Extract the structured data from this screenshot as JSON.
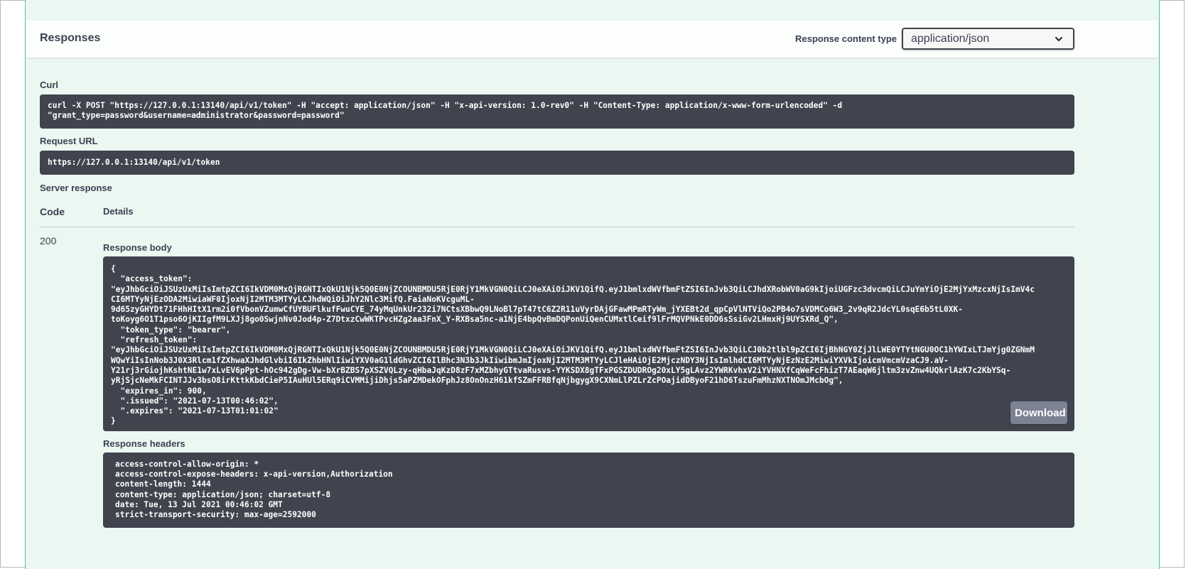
{
  "responses": {
    "title": "Responses",
    "content_type_label": "Response content type",
    "content_type_value": "application/json"
  },
  "curl": {
    "label": "Curl",
    "lines": [
      "curl -X POST \"https://127.0.0.1:13140/api/v1/token\" -H \"accept: application/json\" -H \"x-api-version: 1.0-rev0\" -H \"Content-Type: application/x-www-form-urlencoded\" -d",
      "\"grant_type=password&username=administrator&password=password\""
    ]
  },
  "request_url": {
    "label": "Request URL",
    "value": "https://127.0.0.1:13140/api/v1/token"
  },
  "server_response": {
    "label": "Server response",
    "code_header": "Code",
    "details_header": "Details",
    "status_code": "200",
    "body_label": "Response body",
    "body_lines": [
      "{",
      "  \"access_token\":",
      "\"eyJhbGciOiJSUzUxMiIsImtpZCI6IkVDM0MxQjRGNTIxQkU1Njk5Q0E0NjZCOUNBMDU5RjE0RjY1MkVGN0QiLCJ0eXAiOiJKV1QifQ.eyJ1bmlxdWVfbmFtZSI6InJvb3QiLCJhdXRobWV0aG9kIjoiUGFzc3dvcmQiLCJuYmYiOjE2MjYxMzcxNjIsImV4c",
      "CI6MTYyNjEzODA2MiwiaWF0IjoxNjI2MTM3MTYyLCJhdWQiOiJhY2Nlc3MifQ.FaiaNoKVcguML-",
      "9d65zyGHYDt71FHhHItX1rm2i0fVbonVZumwCfUYBUFlkufFwuCYE_74yMqUnkUr232i7NCtsXBbwQ9LNoBl7pT47tC6Z2R11uVyrDAjGFawMPmRTyWm_jYXEBt2d_qpCpVlNTViQo2PB4o7sVDMCo6W3_2v9qR2JdcYL0sqE6b5tL0XK-",
      "toKoyg6O1T1pso6OjKIIgfM9LXJj8go0SwjnNv0Jod4p-Z7DtxzCwWKTPvcHZg2aa3FnX_Y-RXBsa5nc-a1NjE4bpQvBmDQPonUiQenCUMxtlCeif9lFrMQVPNkE0DD6sSsiGv2LHmxHj9UYSXRd_Q\",",
      "  \"token_type\": \"bearer\",",
      "  \"refresh_token\":",
      "\"eyJhbGciOiJSUzUxMiIsImtpZCI6IkVDM0MxQjRGNTIxQkU1Njk5Q0E0NjZCOUNBMDU5RjE0RjY1MkVGN0QiLCJ0eXAiOiJKV1QifQ.eyJ1bmlxdWVfbmFtZSI6InJvb3QiLCJ0b2tlbl9pZCI6IjBhNGY0ZjJlLWE0YTYtNGU0OC1hYWIxLTJmYjg0ZGNmM",
      "WQwYiIsInNob3J0X3Rlcm1fZXhwaXJhdGlvbiI6IkZhbHNlIiwiYXV0aG1ldGhvZCI6IlBhc3N3b3JkIiwibmJmIjoxNjI2MTM3MTYyLCJleHAiOjE2MjczNDY3NjIsImlhdCI6MTYyNjEzNzE2MiwiYXVkIjoicmVmcmVzaCJ9.aV-",
      "Y21rj3rGiojhKshtNE1w7xLvEV6pPpt-hOc942gDg-Vw-bXrBZBS7pXSZVQLzy-qHbaJqKzD8zF7xMZbhyGTtvaRusvs-YYKSDX8gTFxPGSZDUDROg20xLY5gLAvz2YWRKvhxV2iYVHNXfCqWeFcFhizT7AEaqW6jltm3zvZnw4UQkrlAzK7c2KbYSq-",
      "yRjSjcNeMkFCINTJJv3bsO8irKttkKbdCieP5IAuHUl5ERq9iCVMMijiDhjs5aPZMDekOFphJz8OnOnzH61kfSZmFFRBfqNjbgygX9CXNmLlPZLrZcPOajidDByoF21hD6TszuFmMhzNXTNOmJMcbOg\",",
      "  \"expires_in\": 900,",
      "  \".issued\": \"2021-07-13T00:46:02\",",
      "  \".expires\": \"2021-07-13T01:01:02\"",
      "}"
    ],
    "download_label": "Download",
    "headers_label": "Response headers",
    "header_lines": [
      "access-control-allow-origin: *",
      "access-control-expose-headers: x-api-version,Authorization",
      "content-length: 1444",
      "content-type: application/json; charset=utf-8",
      "date: Tue, 13 Jul 2021 00:46:02 GMT",
      "strict-transport-security: max-age=2592000"
    ]
  },
  "icons": {
    "select_chevron": "chevron-down-icon"
  },
  "colors": {
    "block_background": "#ebf7f1",
    "block_border": "#49cc90",
    "code_background": "#41444e",
    "download_button": "#7d8293"
  }
}
